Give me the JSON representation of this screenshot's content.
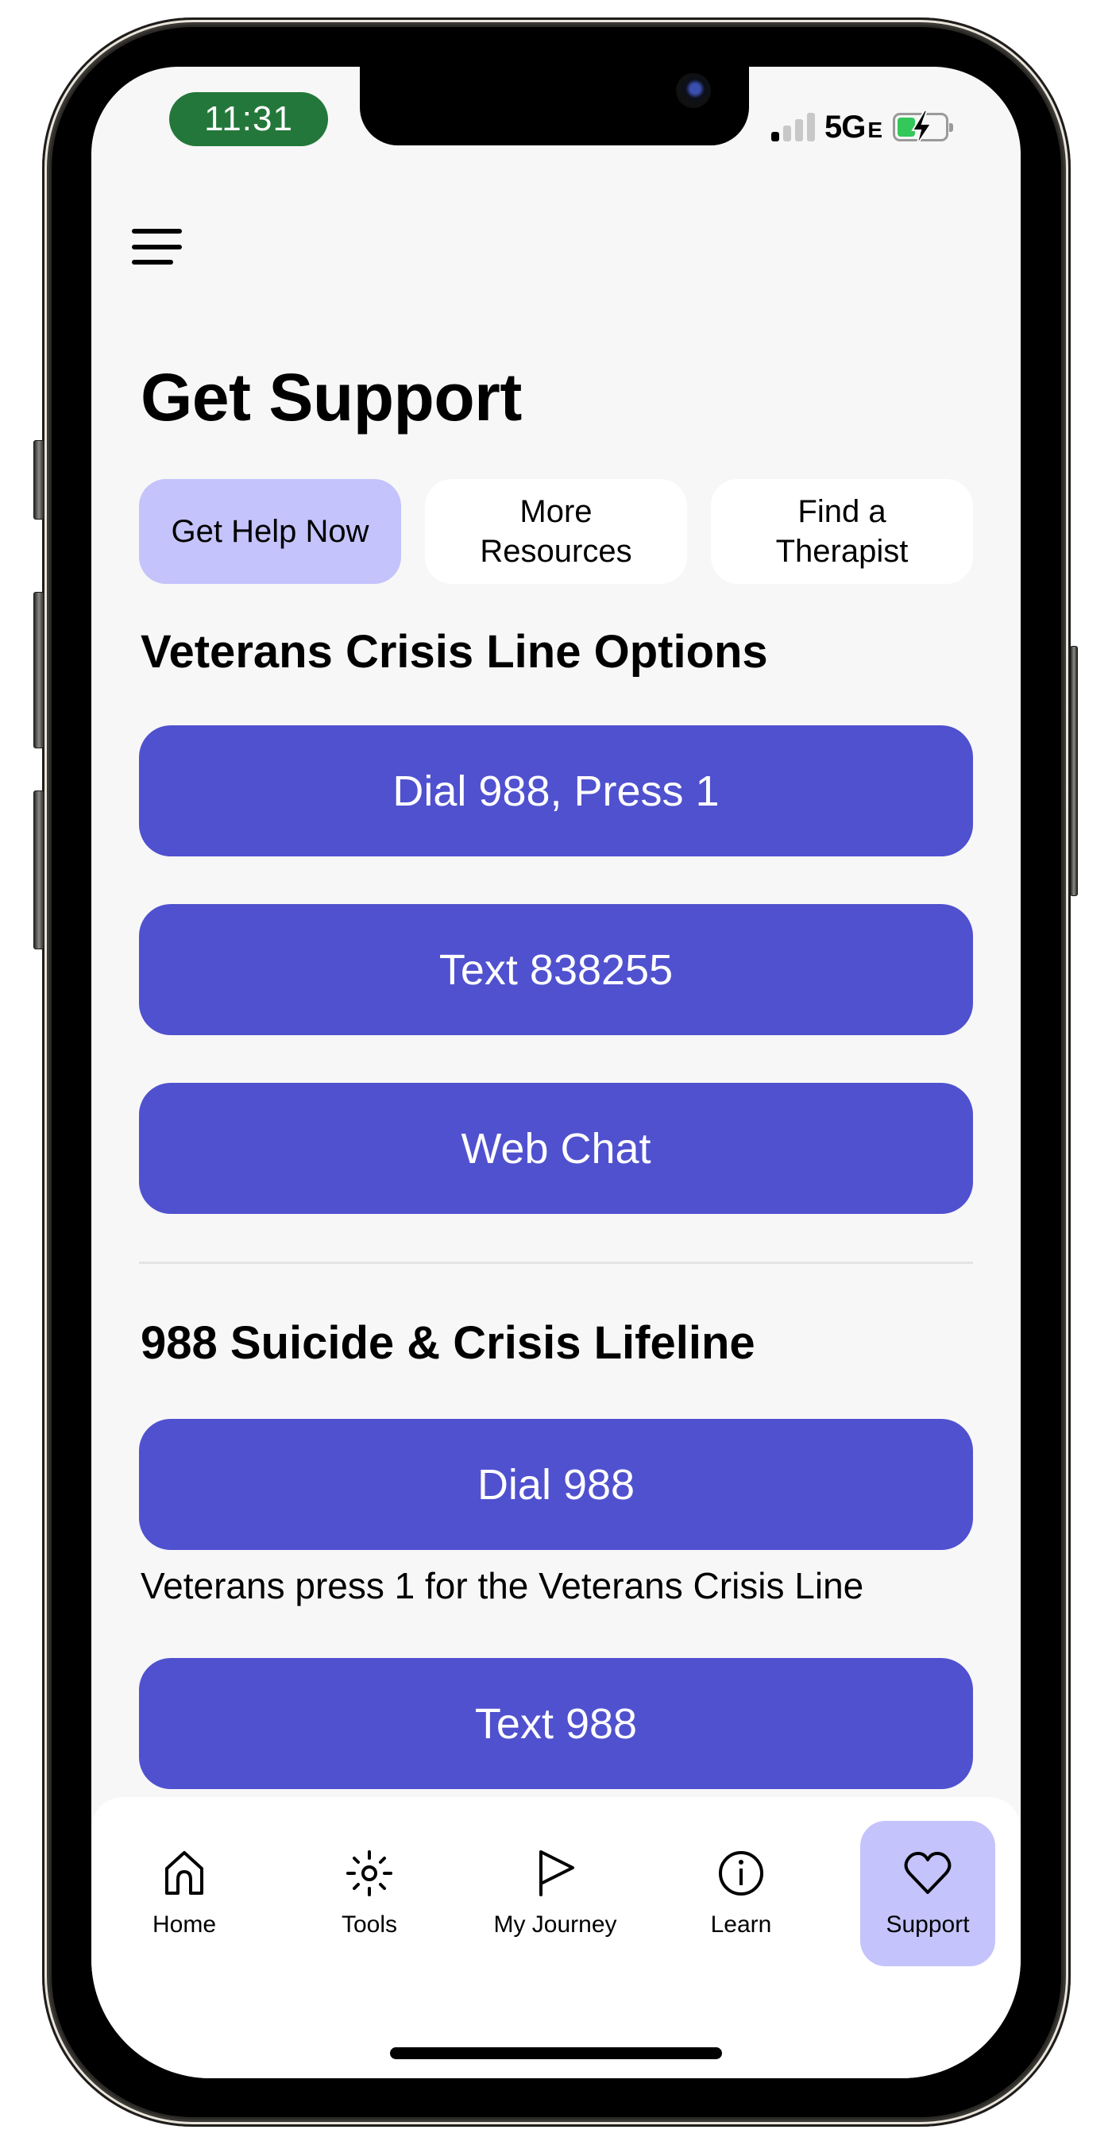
{
  "status_bar": {
    "time": "11:31",
    "network": "5G",
    "network_suffix": "E",
    "signal_bars_active": 1,
    "signal_bars_total": 4,
    "battery_charging": true,
    "colors": {
      "time_pill": "#24773a",
      "battery_fill": "#34c759"
    }
  },
  "header": {
    "menu_icon": "hamburger-menu-icon",
    "title": "Get Support"
  },
  "tabs": [
    {
      "label": "Get Help Now",
      "active": true
    },
    {
      "label": "More\nResources",
      "active": false
    },
    {
      "label": "Find a\nTherapist",
      "active": false
    }
  ],
  "sections": [
    {
      "heading": "Veterans Crisis Line Options",
      "buttons": [
        {
          "label": "Dial 988, Press 1"
        },
        {
          "label": "Text 838255"
        },
        {
          "label": "Web Chat"
        }
      ]
    },
    {
      "heading": "988 Suicide & Crisis Lifeline",
      "buttons": [
        {
          "label": "Dial 988",
          "note": "Veterans press 1 for the Veterans Crisis Line"
        },
        {
          "label": "Text 988"
        }
      ]
    }
  ],
  "bottom_nav": {
    "items": [
      {
        "label": "Home",
        "icon": "home-icon",
        "active": false
      },
      {
        "label": "Tools",
        "icon": "sun-tools-icon",
        "active": false
      },
      {
        "label": "My Journey",
        "icon": "flag-icon",
        "active": false
      },
      {
        "label": "Learn",
        "icon": "info-icon",
        "active": false
      },
      {
        "label": "Support",
        "icon": "heart-icon",
        "active": true
      }
    ]
  },
  "colors": {
    "primary_button": "#5051cf",
    "active_tab": "#c4c3fb",
    "background": "#f7f7f7"
  }
}
